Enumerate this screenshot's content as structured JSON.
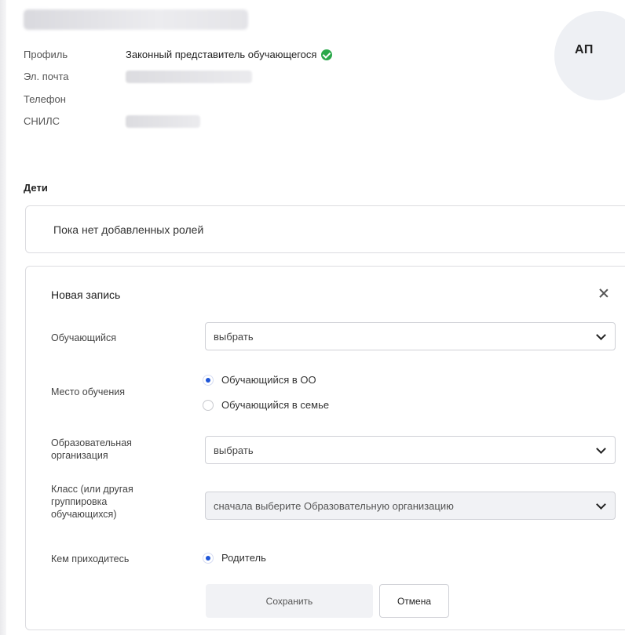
{
  "profile": {
    "avatar_initials": "АП",
    "rows": [
      {
        "label": "Профиль",
        "value": "Законный представитель обучающегося"
      },
      {
        "label": "Эл. почта",
        "value": ""
      },
      {
        "label": "Телефон",
        "value": ""
      },
      {
        "label": "СНИЛС",
        "value": ""
      }
    ]
  },
  "children": {
    "title": "Дети",
    "empty_text": "Пока нет добавленных ролей"
  },
  "new_record": {
    "title": "Новая запись",
    "student_label": "Обучающийся",
    "student_value": "выбрать",
    "place_label": "Место обучения",
    "place_options": [
      {
        "label": "Обучающийся в ОО",
        "checked": true
      },
      {
        "label": "Обучающийся в семье",
        "checked": false
      }
    ],
    "org_label_line1": "Образовательная",
    "org_label_line2": "организация",
    "org_value": "выбрать",
    "class_label_line1": "Класс (или другая",
    "class_label_line2": "группировка",
    "class_label_line3": "обучающихся)",
    "class_value": "сначала выберите Образовательную организацию",
    "relation_label": "Кем приходитесь",
    "relation_option": "Родитель",
    "save_label": "Сохранить",
    "cancel_label": "Отмена"
  },
  "colors": {
    "verified": "#2aa84a",
    "radio_accent": "#1f56d8",
    "border": "#dcdce0"
  }
}
